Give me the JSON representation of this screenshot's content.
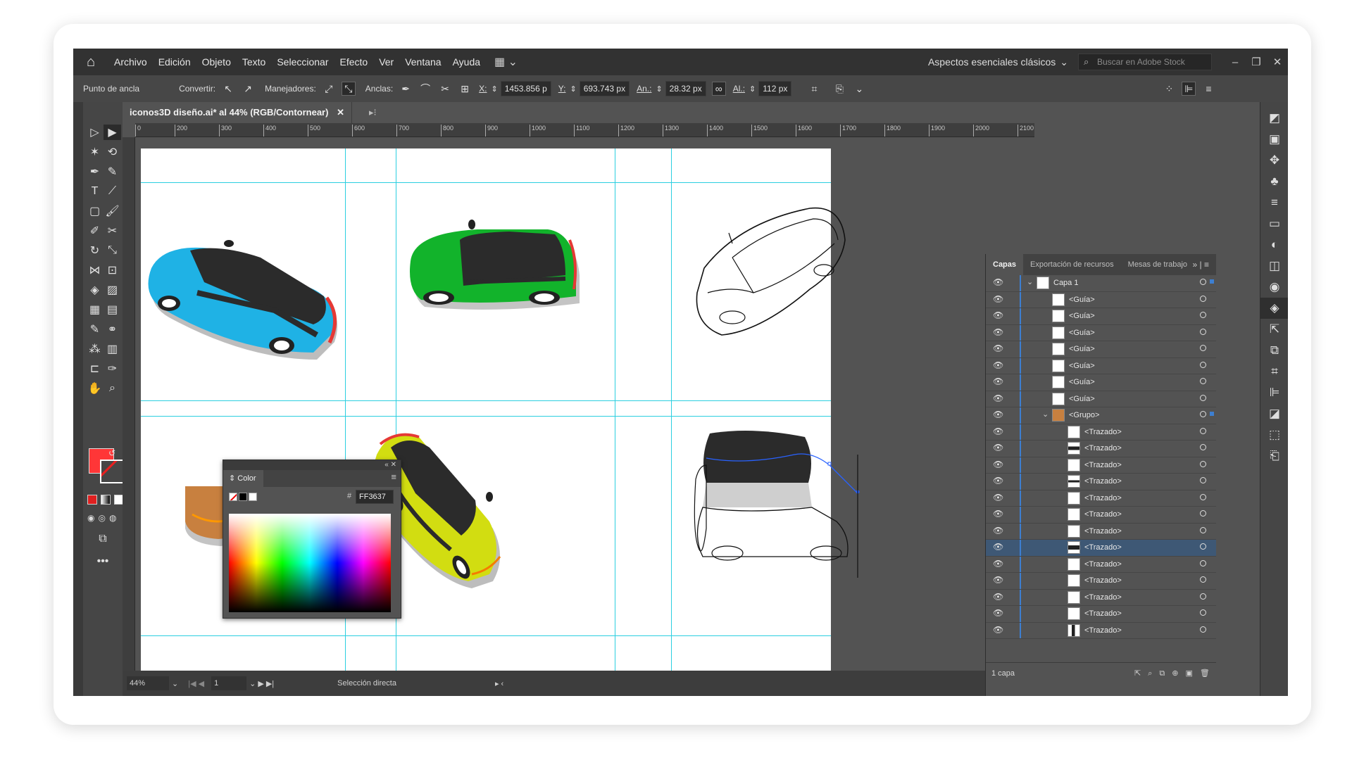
{
  "menubar": {
    "items": [
      "Archivo",
      "Edición",
      "Objeto",
      "Texto",
      "Seleccionar",
      "Efecto",
      "Ver",
      "Ventana",
      "Ayuda"
    ],
    "workspace": "Aspectos esenciales clásicos",
    "search_placeholder": "Buscar en Adobe Stock"
  },
  "controlbar": {
    "anchor_label": "Punto de ancla",
    "convert_label": "Convertir:",
    "handles_label": "Manejadores:",
    "anchors_label": "Anclas:",
    "x_label": "X:",
    "x_value": "1453.856 p",
    "y_label": "Y:",
    "y_value": "693.743 px",
    "w_label": "An.:",
    "w_value": "28.32 px",
    "h_label": "Al.:",
    "h_value": "112 px"
  },
  "document": {
    "tab_title": "iconos3D diseño.ai* al 44% (RGB/Contornear)",
    "ruler_ticks": [
      "0",
      "200",
      "300",
      "400",
      "500",
      "600",
      "700",
      "800",
      "900",
      "1000",
      "1100",
      "1200",
      "1300",
      "1400",
      "1500",
      "1600",
      "1700",
      "1800",
      "1900",
      "2000",
      "2100"
    ]
  },
  "color_panel": {
    "title": "Color",
    "hex_symbol": "#",
    "hex_value": "FF3637"
  },
  "status": {
    "zoom": "44%",
    "artboard": "1",
    "tool": "Selección directa"
  },
  "layers_panel": {
    "tabs": [
      "Capas",
      "Exportación de recursos",
      "Mesas de trabajo"
    ],
    "layer_name": "Capa 1",
    "guide_label": "<Guía>",
    "group_label": "<Grupo>",
    "path_label": "<Trazado>",
    "footer": "1 capa"
  },
  "colors": {
    "fill": "#FF3637",
    "guide": "#2BCFE0",
    "selection": "#3E5875"
  }
}
